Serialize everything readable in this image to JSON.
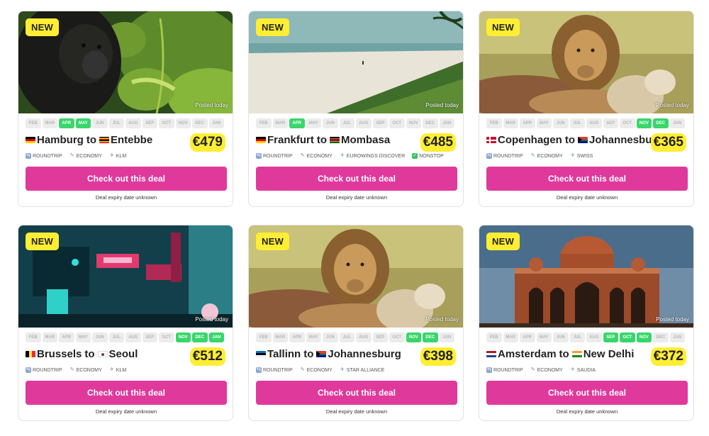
{
  "months": [
    "FEB",
    "MAR",
    "APR",
    "MAY",
    "JUN",
    "JUL",
    "AUG",
    "SEP",
    "OCT",
    "NOV",
    "DEC",
    "JAN"
  ],
  "cta_label": "Check out this deal",
  "expiry_label": "Deal expiry date unknown",
  "posted_label": "Posted today",
  "new_label": "NEW",
  "deals": [
    {
      "from": "Hamburg",
      "to": "Entebbe",
      "joiner": "to",
      "from_flag": "de",
      "to_flag": "ug",
      "price": "€479",
      "active_months": [
        "APR",
        "MAY"
      ],
      "tags": [
        {
          "icon": "roundtrip-icon",
          "label": "ROUNDTRIP"
        },
        {
          "icon": "seat-icon",
          "label": "ECONOMY"
        },
        {
          "icon": "plane-icon",
          "label": "KLM"
        }
      ],
      "image": "gorilla"
    },
    {
      "from": "Frankfurt",
      "to": "Mombasa",
      "joiner": "to",
      "from_flag": "de",
      "to_flag": "ke",
      "price": "€485",
      "active_months": [
        "APR"
      ],
      "tags": [
        {
          "icon": "roundtrip-icon",
          "label": "ROUNDTRIP"
        },
        {
          "icon": "seat-icon",
          "label": "ECONOMY"
        },
        {
          "icon": "plane-icon",
          "label": "EUROWINGS DISCOVER"
        },
        {
          "icon": "check-icon",
          "label": "NONSTOP"
        }
      ],
      "image": "beach"
    },
    {
      "from": "Copenhagen",
      "to": "Johannesburg",
      "joiner": "to",
      "from_flag": "dk",
      "to_flag": "za",
      "price": "€365",
      "active_months": [
        "NOV",
        "DEC"
      ],
      "tags": [
        {
          "icon": "roundtrip-icon",
          "label": "ROUNDTRIP"
        },
        {
          "icon": "seat-icon",
          "label": "ECONOMY"
        },
        {
          "icon": "plane-icon",
          "label": "SWISS"
        }
      ],
      "image": "lion"
    },
    {
      "from": "Brussels",
      "to": "Seoul",
      "joiner": "to",
      "from_flag": "be",
      "to_flag": "kr",
      "price": "€512",
      "active_months": [
        "NOV",
        "DEC",
        "JAN"
      ],
      "tags": [
        {
          "icon": "roundtrip-icon",
          "label": "ROUNDTRIP"
        },
        {
          "icon": "seat-icon",
          "label": "ECONOMY"
        },
        {
          "icon": "plane-icon",
          "label": "KLM"
        }
      ],
      "image": "city"
    },
    {
      "from": "Tallinn",
      "to": "Johannesburg",
      "joiner": "to",
      "from_flag": "ee",
      "to_flag": "za",
      "price": "€398",
      "active_months": [
        "NOV",
        "DEC"
      ],
      "tags": [
        {
          "icon": "roundtrip-icon",
          "label": "ROUNDTRIP"
        },
        {
          "icon": "seat-icon",
          "label": "ECONOMY"
        },
        {
          "icon": "plane-icon",
          "label": "STAR ALLIANCE"
        }
      ],
      "image": "lion"
    },
    {
      "from": "Amsterdam",
      "to": "New Delhi",
      "joiner": "to",
      "from_flag": "nl",
      "to_flag": "in",
      "price": "€372",
      "active_months": [
        "SEP",
        "OCT",
        "NOV"
      ],
      "tags": [
        {
          "icon": "roundtrip-icon",
          "label": "ROUNDTRIP"
        },
        {
          "icon": "seat-icon",
          "label": "ECONOMY"
        },
        {
          "icon": "plane-icon",
          "label": "SAUDIA"
        }
      ],
      "image": "tomb"
    }
  ]
}
